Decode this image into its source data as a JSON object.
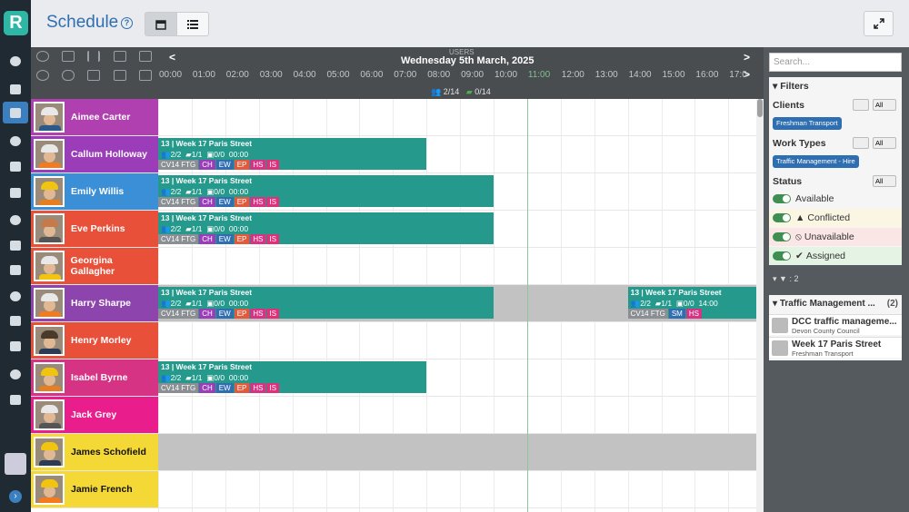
{
  "app": {
    "title": "Schedule",
    "help": "?",
    "logo": "R"
  },
  "colors": {
    "accent": "#2f6fb1",
    "job": "#25998b",
    "CH": "#9b3db8",
    "EW": "#2f6fb1",
    "EP": "#e05a3c",
    "HS": "#d63384",
    "IS": "#e0307a",
    "SM": "#2f6fb1",
    "vehicle": "#8a8f94"
  },
  "sidebar": {
    "icons": [
      "home-icon",
      "documents-icon",
      "calendar-icon",
      "reports-icon",
      "notes-icon",
      "chart-icon",
      "lightbulb-icon",
      "inbox-icon",
      "briefcase-icon",
      "user-icon",
      "mobile-icon",
      "chat-icon",
      "help-icon",
      "settings-icon"
    ],
    "active": "calendar-icon"
  },
  "toolbar": {
    "users_label": "USERS",
    "date": "Wednesday 5th March, 2025",
    "prev": "<",
    "next": ">",
    "people_count": "2/14",
    "vehicle_count": "0/14",
    "hours": [
      "00:00",
      "01:00",
      "02:00",
      "03:00",
      "04:00",
      "05:00",
      "06:00",
      "07:00",
      "08:00",
      "09:00",
      "10:00",
      "11:00",
      "12:00",
      "13:00",
      "14:00",
      "15:00",
      "16:00",
      "17:0"
    ]
  },
  "rows": [
    {
      "name": "Aimee Carter",
      "color": "#b03fb0",
      "hat": "#e8e8e8",
      "body": "#2b5a8a",
      "grey": false,
      "jobs": []
    },
    {
      "name": "Callum Holloway",
      "color": "#9b3db8",
      "hat": "#e8e8e8",
      "body": "#f47a20",
      "grey": false,
      "jobs": [
        {
          "start": 0,
          "end": 8
        }
      ]
    },
    {
      "name": "Emily Willis",
      "color": "#3a8fd6",
      "hat": "#f1c40f",
      "body": "#e67e22",
      "grey": false,
      "jobs": [
        {
          "start": 0,
          "end": 10
        }
      ]
    },
    {
      "name": "Eve Perkins",
      "color": "#e8503a",
      "hat": "#c57a4a",
      "body": "#555",
      "grey": false,
      "jobs": [
        {
          "start": 0,
          "end": 10
        }
      ]
    },
    {
      "name": "Georgina Gallagher",
      "color": "#e8503a",
      "hat": "#e8e8e8",
      "body": "#f1c40f",
      "grey": false,
      "jobs": []
    },
    {
      "name": "Harry Sharpe",
      "color": "#8e44ad",
      "hat": "#e8e8e8",
      "body": "#f47a20",
      "grey": true,
      "jobs": [
        {
          "start": 0,
          "end": 10
        },
        {
          "start": 14,
          "end": 18,
          "time": "14:00",
          "chips": [
            "SM",
            "HS"
          ]
        }
      ]
    },
    {
      "name": "Henry Morley",
      "color": "#e8503a",
      "hat": "#4a3a2a",
      "body": "#2b3a55",
      "grey": false,
      "jobs": []
    },
    {
      "name": "Isabel Byrne",
      "color": "#d63384",
      "hat": "#f1c40f",
      "body": "#e67e22",
      "grey": false,
      "jobs": [
        {
          "start": 0,
          "end": 8
        }
      ]
    },
    {
      "name": "Jack Grey",
      "color": "#e91e8c",
      "hat": "#e8e8e8",
      "body": "#555",
      "grey": false,
      "jobs": []
    },
    {
      "name": "James Schofield",
      "color": "#f4d836",
      "hat": "#f1c40f",
      "body": "#2b3a55",
      "grey": true,
      "dark": true,
      "jobs": []
    },
    {
      "name": "Jamie French",
      "color": "#f4d836",
      "hat": "#f1c40f",
      "body": "#f47a20",
      "grey": false,
      "dark": true,
      "jobs": []
    }
  ],
  "job": {
    "title": "13 | Week 17 Paris Street",
    "people": "2/2",
    "vehicles": "1/1",
    "equipment": "0/0",
    "time": "00:00",
    "vehicle_reg": "CV14 FTG",
    "chips": [
      "CH",
      "EW",
      "EP",
      "HS",
      "IS"
    ]
  },
  "panel": {
    "search_placeholder": "Search...",
    "filters_title": "Filters",
    "clients_label": "Clients",
    "all": "All",
    "client_pill": "Freshman Transport",
    "work_types_label": "Work Types",
    "work_pill": "Traffic Management - Hire",
    "status_label": "Status",
    "statuses": [
      {
        "label": "Available",
        "bg": "#f5f5f5",
        "icon": ""
      },
      {
        "label": "Conflicted",
        "bg": "#fbf6e4",
        "icon": "▲"
      },
      {
        "label": "Unavailable",
        "bg": "#fbe6e6",
        "icon": "⦸"
      },
      {
        "label": "Assigned",
        "bg": "#e4f3e4",
        "icon": "✔"
      }
    ],
    "filter_count": ": 2",
    "group_title": "Traffic Management ...",
    "group_count": "(2)",
    "items": [
      {
        "title": "DCC traffic manageme...",
        "sub": "Devon County Council"
      },
      {
        "title": "Week 17 Paris Street",
        "sub": "Freshman Transport"
      }
    ]
  }
}
